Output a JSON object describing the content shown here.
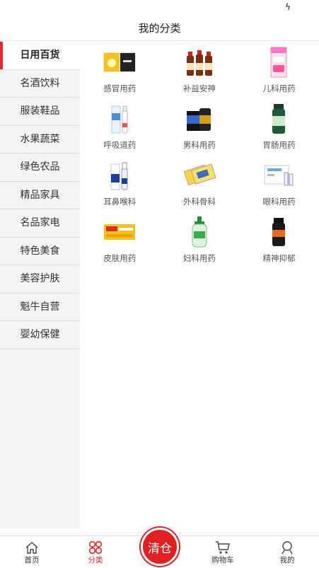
{
  "header": {
    "title": "我的分类"
  },
  "sidebar": {
    "items": [
      {
        "label": "日用百货",
        "active": true
      },
      {
        "label": "名酒饮料"
      },
      {
        "label": "服装鞋品"
      },
      {
        "label": "水果蔬菜"
      },
      {
        "label": "绿色农品"
      },
      {
        "label": "精品家具"
      },
      {
        "label": "名品家电"
      },
      {
        "label": "特色美食"
      },
      {
        "label": "美容护肤"
      },
      {
        "label": "魁牛自营"
      },
      {
        "label": "婴幼保健"
      }
    ]
  },
  "categories": [
    {
      "label": "感冒用药",
      "icon": "cold-medicine-box-icon"
    },
    {
      "label": "补益安神",
      "icon": "tonic-bottles-icon"
    },
    {
      "label": "儿科用药",
      "icon": "pediatric-medicine-box-icon"
    },
    {
      "label": "呼吸道药",
      "icon": "nasal-spray-icon"
    },
    {
      "label": "男科用药",
      "icon": "mens-medicine-jar-icon"
    },
    {
      "label": "胃肠用药",
      "icon": "stomach-medicine-bottle-icon"
    },
    {
      "label": "耳鼻喉科",
      "icon": "ent-spray-icon"
    },
    {
      "label": "外科骨科",
      "icon": "plasters-icon"
    },
    {
      "label": "眼科用药",
      "icon": "eye-drops-box-icon"
    },
    {
      "label": "皮肤用药",
      "icon": "skin-ointment-box-icon"
    },
    {
      "label": "妇科用药",
      "icon": "gynecology-lotion-icon"
    },
    {
      "label": "精神抑郁",
      "icon": "mood-supplement-bottle-icon"
    }
  ],
  "bottom_nav": {
    "home": "首页",
    "category": "分类",
    "clearance": "清仓",
    "cart": "购物车",
    "mine": "我的"
  },
  "colors": {
    "accent": "#e12b2b",
    "sidebar_bg": "#f4f4f4"
  }
}
